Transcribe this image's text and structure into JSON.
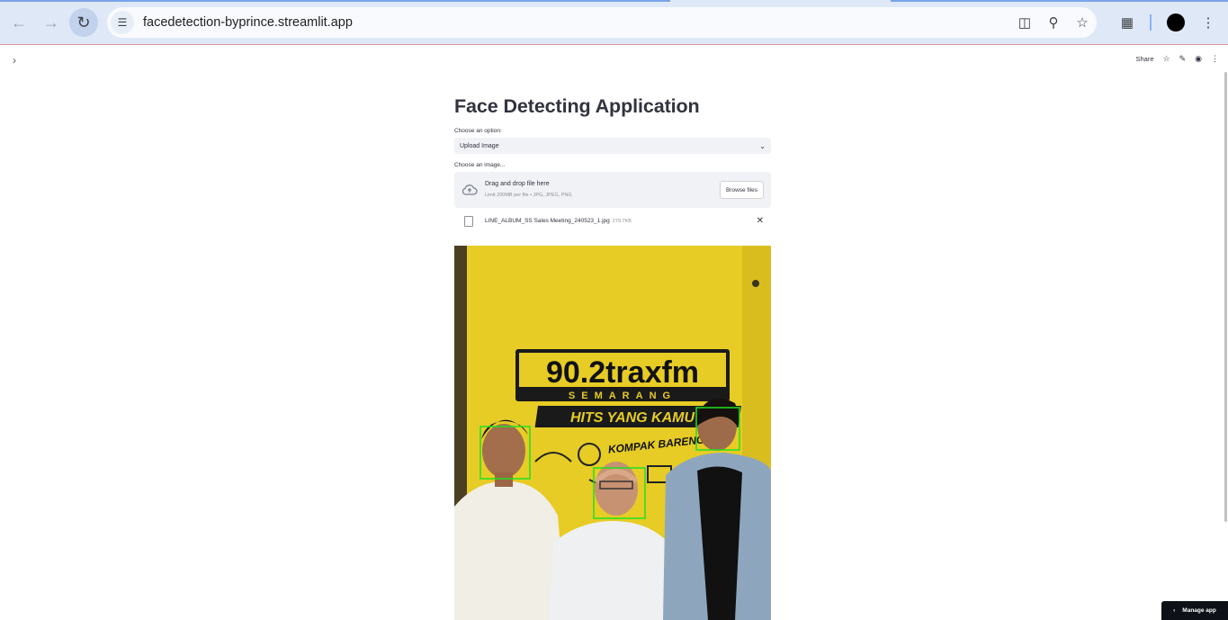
{
  "browser": {
    "url": "facedetection-byprince.streamlit.app"
  },
  "header": {
    "share_label": "Share"
  },
  "main": {
    "title": "Face Detecting Application",
    "option_label": "Choose an option:",
    "option_value": "Upload Image",
    "image_label": "Choose an image...",
    "dropzone_title": "Drag and drop file here",
    "dropzone_limit": "Limit 200MB per file • JPG, JPEG, PNG",
    "browse_label": "Browse files",
    "file_name": "LINE_ALBUM_SS Sales Meeting_240523_1.jpg",
    "file_size": "279.7KB"
  },
  "photo": {
    "sign_line1": "90.2traxfm",
    "sign_line2": "SEMARANG",
    "sign_line3": "HITS YANG KAMU",
    "sign_line4": "KOMPAK BARENG"
  },
  "footer": {
    "manage_label": "Manage app"
  },
  "colors": {
    "accent": "#ff4b4b",
    "face_box": "#21e021",
    "wall": "#e8cf2a"
  }
}
